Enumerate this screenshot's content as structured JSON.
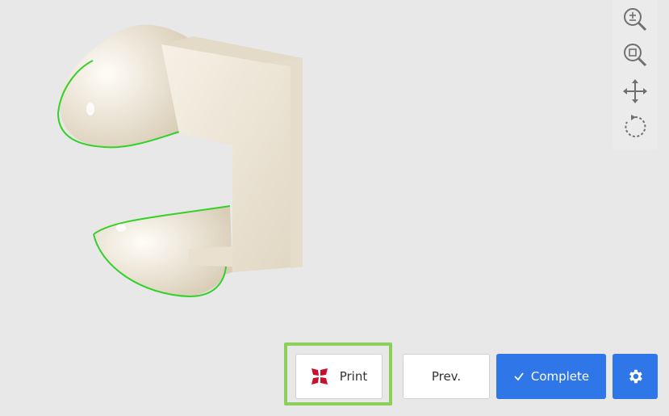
{
  "buttons": {
    "print_label": "Print",
    "prev_label": "Prev.",
    "complete_label": "Complete"
  },
  "toolbar": {
    "tools": [
      {
        "icon": "zoom-in-icon"
      },
      {
        "icon": "zoom-fit-icon"
      },
      {
        "icon": "pan-icon"
      },
      {
        "icon": "rotate-icon"
      }
    ]
  },
  "icons": {
    "complete": "check-icon",
    "settings": "gear-icon",
    "print": "print-logo-icon"
  },
  "colors": {
    "primary": "#2f76e8",
    "highlight": "#8bd05a",
    "brand_red": "#c8102e",
    "model": "#efe7d8",
    "outline": "#34d12a"
  }
}
